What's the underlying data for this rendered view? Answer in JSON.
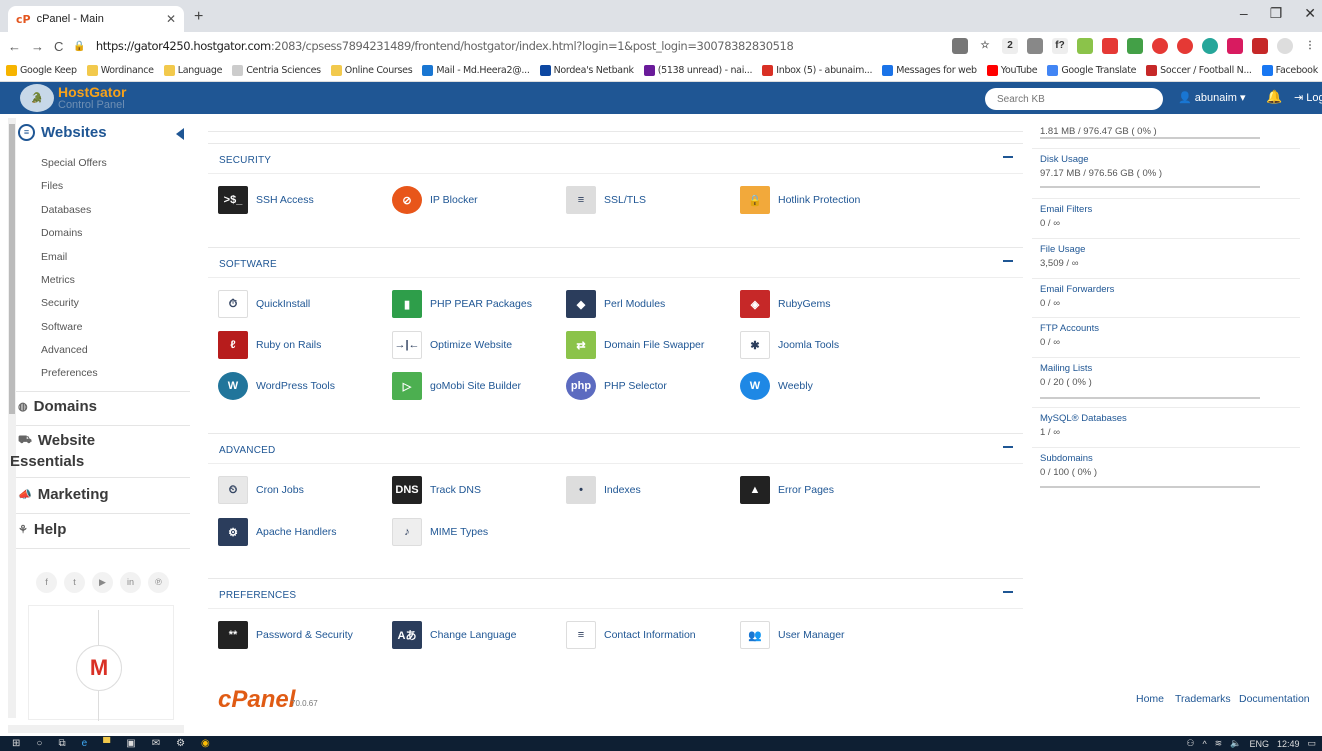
{
  "browser": {
    "tab_title": "cPanel - Main",
    "url_host": "https://gator4250.hostgator.com",
    "url_rest": ":2083/cpsess7894231489/frontend/hostgator/index.html?login=1&post_login=30078382830518"
  },
  "bookmarks": [
    {
      "label": "Google Keep",
      "color": "#f6b400"
    },
    {
      "label": "Wordinance",
      "color": "#f2c94c"
    },
    {
      "label": "Language",
      "color": "#f2c94c"
    },
    {
      "label": "Centria Sciences",
      "color": "#cccccc"
    },
    {
      "label": "Online Courses",
      "color": "#f2c94c"
    },
    {
      "label": "Mail - Md.Heera2@...",
      "color": "#1976d2"
    },
    {
      "label": "Nordea's Netbank",
      "color": "#0d47a1"
    },
    {
      "label": "(5138 unread) - nai...",
      "color": "#6a1b9a"
    },
    {
      "label": "Inbox (5) - abunaim...",
      "color": "#d93025"
    },
    {
      "label": "Messages for web",
      "color": "#1a73e8"
    },
    {
      "label": "YouTube",
      "color": "#ff0000"
    },
    {
      "label": "Google Translate",
      "color": "#4285f4"
    },
    {
      "label": "Soccer / Football N...",
      "color": "#c62828"
    },
    {
      "label": "Facebook",
      "color": "#1877f2"
    }
  ],
  "header": {
    "brand": "HostGator",
    "sub": "Control Panel",
    "search_placeholder": "Search KB",
    "user": "abunaim",
    "logout": "Logout"
  },
  "sidebar": {
    "websites": "Websites",
    "items": [
      "Special Offers",
      "Files",
      "Databases",
      "Domains",
      "Email",
      "Metrics",
      "Security",
      "Software",
      "Advanced",
      "Preferences"
    ],
    "domains": "Domains",
    "website": "Website",
    "essentials": "Essentials",
    "marketing": "Marketing",
    "help": "Help"
  },
  "sections": {
    "security": {
      "title": "SECURITY",
      "items": [
        "SSH Access",
        "IP Blocker",
        "SSL/TLS",
        "Hotlink Protection"
      ]
    },
    "software": {
      "title": "SOFTWARE",
      "items": [
        "QuickInstall",
        "PHP PEAR Packages",
        "Perl Modules",
        "RubyGems",
        "Ruby on Rails",
        "Optimize Website",
        "Domain File Swapper",
        "Joomla Tools",
        "WordPress Tools",
        "goMobi Site Builder",
        "PHP Selector",
        "Weebly"
      ]
    },
    "advanced": {
      "title": "ADVANCED",
      "items": [
        "Cron Jobs",
        "Track DNS",
        "Indexes",
        "Error Pages",
        "Apache Handlers",
        "MIME Types"
      ]
    },
    "preferences": {
      "title": "PREFERENCES",
      "items": [
        "Password & Security",
        "Change Language",
        "Contact Information",
        "User Manager"
      ]
    }
  },
  "stats": {
    "top_value": "1.81 MB / 976.47 GB ( 0% )",
    "rows": [
      {
        "label": "Disk Usage",
        "value": "97.17 MB / 976.56 GB ( 0% )"
      },
      {
        "label": "Email Filters",
        "value": "0 / ∞"
      },
      {
        "label": "File Usage",
        "value": "3,509 / ∞"
      },
      {
        "label": "Email Forwarders",
        "value": "0 / ∞"
      },
      {
        "label": "FTP Accounts",
        "value": "0 / ∞"
      },
      {
        "label": "Mailing Lists",
        "value": "0 / 20 ( 0% )"
      },
      {
        "label": "MySQL® Databases",
        "value": "1 / ∞"
      },
      {
        "label": "Subdomains",
        "value": "0 / 100 ( 0% )"
      }
    ]
  },
  "footer": {
    "brand": "cPanel",
    "version": "70.0.67",
    "home": "Home",
    "trademarks": "Trademarks",
    "documentation": "Documentation"
  },
  "tray": {
    "lang": "ENG",
    "time": "12:49"
  }
}
